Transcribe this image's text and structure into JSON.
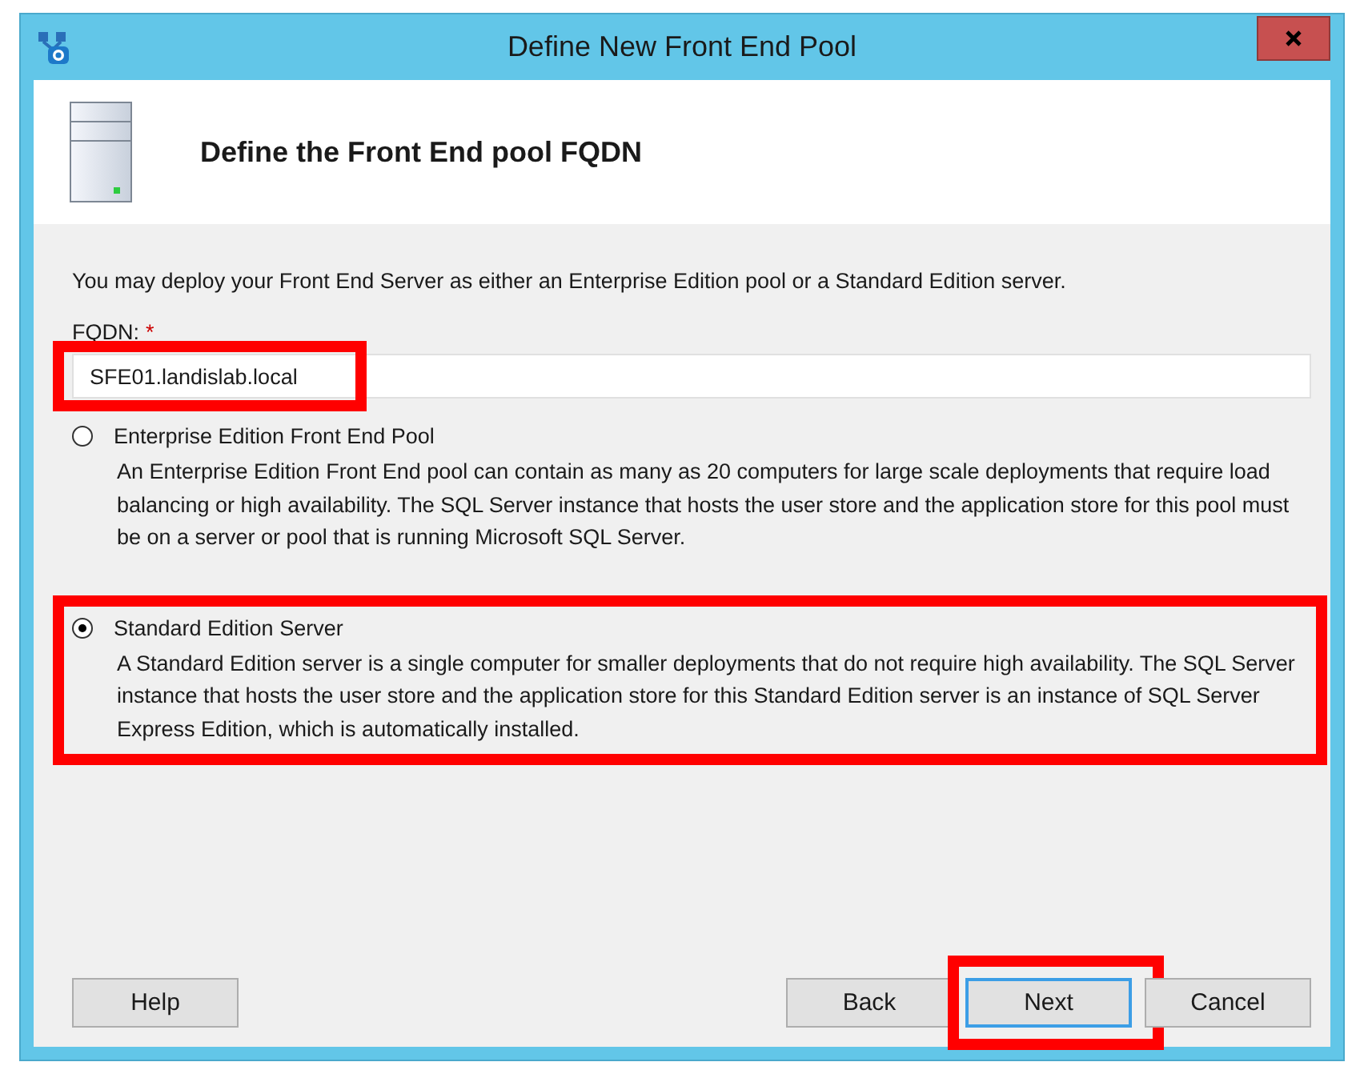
{
  "window": {
    "title": "Define New Front End Pool"
  },
  "header": {
    "title": "Define the Front End pool FQDN"
  },
  "intro": "You may deploy your Front End Server as either an Enterprise Edition pool or a Standard Edition server.",
  "fqdn": {
    "label": "FQDN:",
    "required_mark": "*",
    "value": "SFE01.landislab.local",
    "highlighted": true
  },
  "options": [
    {
      "label": "Enterprise Edition Front End Pool",
      "selected": false,
      "highlighted": false,
      "description": "An Enterprise Edition Front End pool can contain as many as 20 computers for large scale deployments that require load balancing or high availability. The SQL Server instance that hosts the user store and the application store for this pool must be on a server or pool that is running Microsoft SQL Server."
    },
    {
      "label": "Standard Edition Server",
      "selected": true,
      "highlighted": true,
      "description": "A Standard Edition server is a single computer for smaller deployments that do not require high availability. The SQL Server instance that hosts the user store and the application store for this Standard Edition server is an instance of SQL Server Express Edition, which is automatically installed."
    }
  ],
  "help_button": {
    "label": "Help"
  },
  "nav_buttons": [
    {
      "label": "Back",
      "focused": false,
      "highlighted": false
    },
    {
      "label": "Next",
      "focused": true,
      "highlighted": true
    },
    {
      "label": "Cancel",
      "focused": false,
      "highlighted": false
    }
  ]
}
